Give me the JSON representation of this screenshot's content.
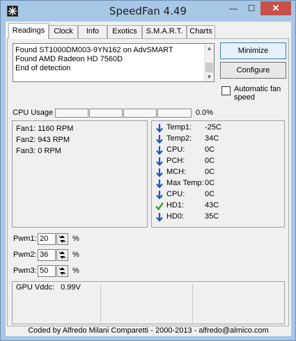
{
  "window": {
    "title": "SpeedFan 4.49",
    "controls": {
      "minimize": "—",
      "maximize": "☐",
      "close": "✕"
    },
    "icon": "speedfan-app-icon"
  },
  "tabs": [
    "Readings",
    "Clock",
    "Info",
    "Exotics",
    "S.M.A.R.T.",
    "Charts"
  ],
  "active_tab": "Readings",
  "log": {
    "lines": [
      "Found ST1000DM003-9YN162 on AdvSMART",
      "Found AMD Radeon HD 7560D",
      "End of detection"
    ]
  },
  "buttons": {
    "minimize": "Minimize",
    "configure": "Configure"
  },
  "auto_fan": {
    "label_line1": "Automatic fan",
    "label_line2": "speed",
    "checked": false
  },
  "cpu_usage": {
    "label": "CPU Usage",
    "percent": "0.0%",
    "bars": [
      0,
      0,
      0,
      0
    ]
  },
  "fans": [
    {
      "name": "Fan1:",
      "value": "1160 RPM"
    },
    {
      "name": "Fan2:",
      "value": "943 RPM"
    },
    {
      "name": "Fan3:",
      "value": "0 RPM"
    }
  ],
  "temps": [
    {
      "name": "Temp1:",
      "value": "-25C",
      "icon": "arrow-down-icon"
    },
    {
      "name": "Temp2:",
      "value": "34C",
      "icon": "arrow-down-icon"
    },
    {
      "name": "CPU:",
      "value": "0C",
      "icon": "arrow-down-icon"
    },
    {
      "name": "PCH:",
      "value": "0C",
      "icon": "arrow-down-icon"
    },
    {
      "name": "MCH:",
      "value": "0C",
      "icon": "arrow-down-icon"
    },
    {
      "name": "Max Temp:",
      "value": "0C",
      "icon": "arrow-down-icon"
    },
    {
      "name": "CPU:",
      "value": "0C",
      "icon": "arrow-down-icon"
    },
    {
      "name": "HD1:",
      "value": "43C",
      "icon": "checkmark-icon"
    },
    {
      "name": "HD0:",
      "value": "35C",
      "icon": "arrow-down-icon"
    }
  ],
  "pwm": [
    {
      "label": "Pwm1:",
      "value": "20",
      "unit": "%"
    },
    {
      "label": "Pwm2:",
      "value": "36",
      "unit": "%"
    },
    {
      "label": "Pwm3:",
      "value": "50",
      "unit": "%"
    }
  ],
  "gpu": {
    "label": "GPU Vddc:",
    "value": "0.99V"
  },
  "footer": "Coded by Alfredo Milani Comparetti - 2000-2013 - alfredo@almico.com",
  "colors": {
    "arrow_blue": "#1a55c8",
    "check_green": "#2e9e2e",
    "frame_blue": "#a7c7e7"
  }
}
